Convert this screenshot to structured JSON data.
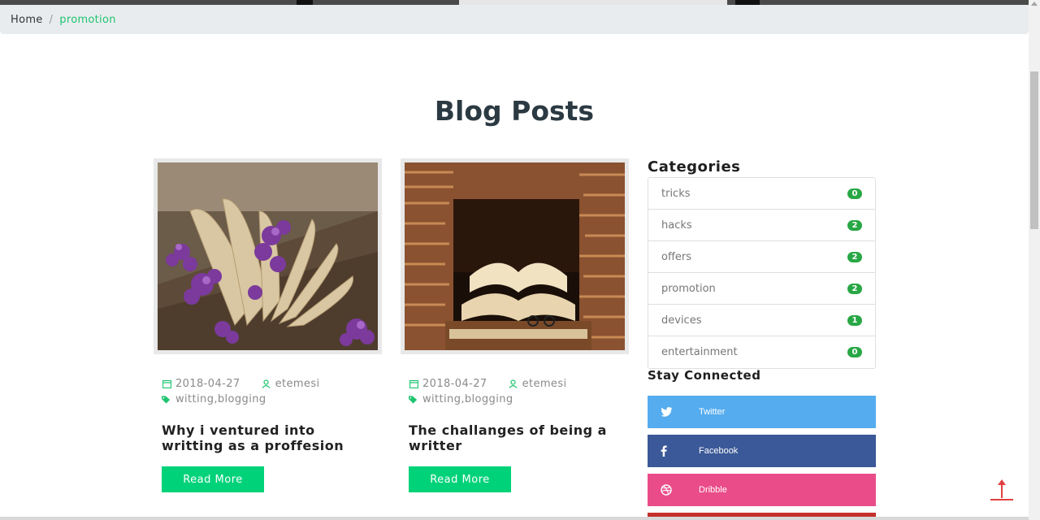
{
  "breadcrumb": {
    "home": "Home",
    "separator": "/",
    "current": "promotion"
  },
  "page": {
    "title": "Blog Posts"
  },
  "posts": [
    {
      "date": "2018-04-27",
      "author": "etemesi",
      "tags": "witting,blogging",
      "title": "Why i ventured into writting as a proffesion",
      "button": "Read More"
    },
    {
      "date": "2018-04-27",
      "author": "etemesi",
      "tags": "witting,blogging",
      "title": "The challanges of being a writter",
      "button": "Read More"
    }
  ],
  "categories": {
    "heading": "Categories",
    "items": [
      {
        "label": "tricks",
        "count": "0"
      },
      {
        "label": "hacks",
        "count": "2"
      },
      {
        "label": "offers",
        "count": "2"
      },
      {
        "label": "promotion",
        "count": "2"
      },
      {
        "label": "devices",
        "count": "1"
      },
      {
        "label": "entertainment",
        "count": "0"
      }
    ]
  },
  "social": {
    "heading": "Stay Connected",
    "links": [
      {
        "label": "Twitter",
        "icon": "twitter-icon",
        "color": "#55acee"
      },
      {
        "label": "Facebook",
        "icon": "facebook-icon",
        "color": "#3b5998"
      },
      {
        "label": "Dribble",
        "icon": "dribbble-icon",
        "color": "#ea4c89"
      }
    ]
  },
  "colors": {
    "accent": "#00d27a",
    "breadcrumb_active": "#1fc46f",
    "badge": "#28a745",
    "back_to_top": "#e04040"
  }
}
